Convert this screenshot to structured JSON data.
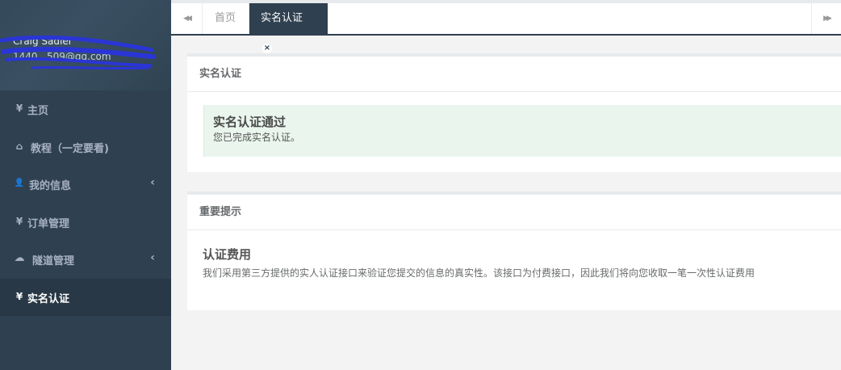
{
  "sidebar": {
    "profile": {
      "name": "Craig Sadler",
      "email": "1440...509@qq.com"
    },
    "items": [
      {
        "icon": "yen-icon",
        "glyph": "¥",
        "label": "主页"
      },
      {
        "icon": "home-icon",
        "glyph": "⌂",
        "label": "教程（一定要看)"
      },
      {
        "icon": "user-icon",
        "glyph": "👤",
        "label": "我的信息",
        "arrow": "‹"
      },
      {
        "icon": "yen-icon",
        "glyph": "¥",
        "label": "订单管理"
      },
      {
        "icon": "cloud-icon",
        "glyph": "☁",
        "label": "隧道管理",
        "arrow": "‹"
      },
      {
        "icon": "yen-icon",
        "glyph": "¥",
        "label": "实名认证"
      }
    ]
  },
  "tabs": {
    "scroll_left": "◀◀",
    "scroll_right": "▶▶",
    "home": "首页",
    "current": "实名认证",
    "close": "×"
  },
  "panel1": {
    "title": "实名认证",
    "alert_title": "实名认证通过",
    "alert_text": "您已完成实名认证。"
  },
  "panel2": {
    "title": "重要提示",
    "heading": "认证费用",
    "text": "我们采用第三方提供的实人认证接口来验证您提交的信息的真实性。该接口为付费接口，因此我们将向您收取一笔一次性认证费用"
  },
  "colors": {
    "sidebar": "#2f4050",
    "active": "#293846",
    "alert_bg": "#eaf5ee"
  }
}
